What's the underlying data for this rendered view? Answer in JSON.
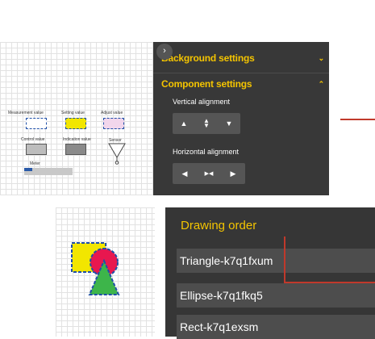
{
  "top_panel": {
    "collapse_icon": "chevron-right-icon",
    "background_settings": {
      "label": "Background settings",
      "icon": "chevron-down-icon"
    },
    "component_settings": {
      "label": "Component settings",
      "icon": "chevron-up-icon"
    },
    "vertical_alignment": {
      "label": "Vertical alignment",
      "icons": [
        "align-top-icon",
        "align-middle-icon",
        "align-bottom-icon"
      ]
    },
    "horizontal_alignment": {
      "label": "Horizontal alignment",
      "icons": [
        "align-left-icon",
        "align-center-icon",
        "align-right-icon"
      ]
    }
  },
  "palette": {
    "measurement": "Measurement value",
    "setting": "Setting value",
    "adjust": "Adjust value",
    "control": "Control value",
    "indication": "Indication value",
    "sensor": "Sensor",
    "meter": "Meter"
  },
  "drawing_order": {
    "title": "Drawing order",
    "items": [
      "Triangle-k7q1fxum",
      "Ellipse-k7q1fkq5",
      "Rect-k7q1exsm"
    ]
  },
  "colors": {
    "accent": "#f4c400",
    "panel_bg": "#383838",
    "highlight": "#c0392b",
    "rect_fill": "#f2e600",
    "ellipse_fill": "#e8174f",
    "triangle_fill": "#3db54a"
  }
}
